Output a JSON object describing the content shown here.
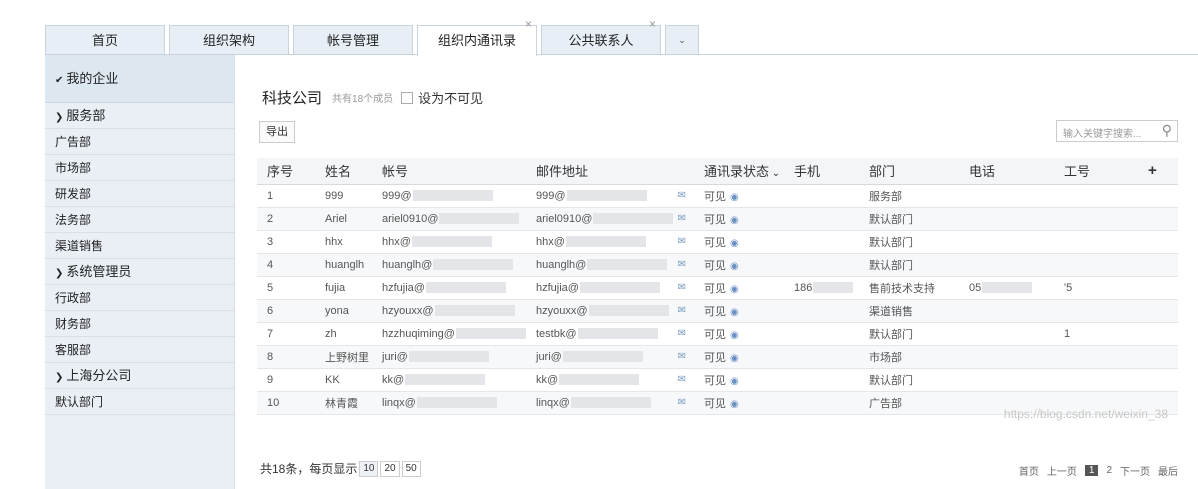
{
  "tabs": [
    {
      "label": "首页",
      "active": false,
      "closable": false
    },
    {
      "label": "组织架构",
      "active": false,
      "closable": false
    },
    {
      "label": "帐号管理",
      "active": false,
      "closable": false
    },
    {
      "label": "组织内通讯录",
      "active": true,
      "closable": true
    },
    {
      "label": "公共联系人",
      "active": false,
      "closable": true
    }
  ],
  "sidebar": {
    "header": "我的企业",
    "items": [
      {
        "label": "服务部",
        "group": true
      },
      {
        "label": "广告部",
        "group": false
      },
      {
        "label": "市场部",
        "group": false
      },
      {
        "label": "研发部",
        "group": false
      },
      {
        "label": "法务部",
        "group": false
      },
      {
        "label": "渠道销售",
        "group": false
      },
      {
        "label": "系统管理员",
        "group": true
      },
      {
        "label": "行政部",
        "group": false
      },
      {
        "label": "财务部",
        "group": false
      },
      {
        "label": "客服部",
        "group": false
      },
      {
        "label": "上海分公司",
        "group": true
      },
      {
        "label": "默认部门",
        "group": false
      }
    ]
  },
  "main": {
    "company": "科技公司",
    "member_count": "共有18个成员",
    "invisible_label": "设为不可见",
    "export_label": "导出",
    "search_placeholder": "输入关键字搜索...",
    "columns": [
      "序号",
      "姓名",
      "帐号",
      "邮件地址",
      "通讯录状态",
      "手机",
      "部门",
      "电话",
      "工号",
      "+"
    ],
    "rows": [
      {
        "no": "1",
        "name": "999",
        "account": "999@",
        "email": "999@",
        "status": "可见",
        "mobile": "",
        "dept": "服务部",
        "phone": "",
        "empno": ""
      },
      {
        "no": "2",
        "name": "Ariel",
        "account": "ariel0910@",
        "email": "ariel0910@",
        "status": "可见",
        "mobile": "",
        "dept": "默认部门",
        "phone": "",
        "empno": ""
      },
      {
        "no": "3",
        "name": "hhx",
        "account": "hhx@",
        "email": "hhx@",
        "status": "可见",
        "mobile": "",
        "dept": "默认部门",
        "phone": "",
        "empno": ""
      },
      {
        "no": "4",
        "name": "huanglh",
        "account": "huanglh@",
        "email": "huanglh@",
        "status": "可见",
        "mobile": "",
        "dept": "默认部门",
        "phone": "",
        "empno": ""
      },
      {
        "no": "5",
        "name": "fujia",
        "account": "hzfujia@",
        "email": "hzfujia@",
        "status": "可见",
        "mobile": "186",
        "dept": "售前技术支持",
        "phone": "05",
        "empno": "'5"
      },
      {
        "no": "6",
        "name": "yona",
        "account": "hzyouxx@",
        "email": "hzyouxx@",
        "status": "可见",
        "mobile": "",
        "dept": "渠道销售",
        "phone": "",
        "empno": ""
      },
      {
        "no": "7",
        "name": "zh",
        "account": "hzzhuqiming@",
        "email": "testbk@",
        "status": "可见",
        "mobile": "",
        "dept": "默认部门",
        "phone": "",
        "empno": "1"
      },
      {
        "no": "8",
        "name": "上野树里",
        "account": "juri@",
        "email": "juri@",
        "status": "可见",
        "mobile": "",
        "dept": "市场部",
        "phone": "",
        "empno": ""
      },
      {
        "no": "9",
        "name": "KK",
        "account": "kk@",
        "email": "kk@",
        "status": "可见",
        "mobile": "",
        "dept": "默认部门",
        "phone": "",
        "empno": ""
      },
      {
        "no": "10",
        "name": "林青霞",
        "account": "linqx@",
        "email": "linqx@",
        "status": "可见",
        "mobile": "",
        "dept": "广告部",
        "phone": "",
        "empno": ""
      }
    ],
    "footer": {
      "total_text": "共18条，每页显示",
      "page_sizes": [
        "10",
        "20",
        "50"
      ],
      "pager": [
        "首页",
        "上一页",
        "1",
        "2",
        "下一页",
        "最后"
      ]
    }
  },
  "watermark": "https://blog.csdn.net/weixin_38"
}
